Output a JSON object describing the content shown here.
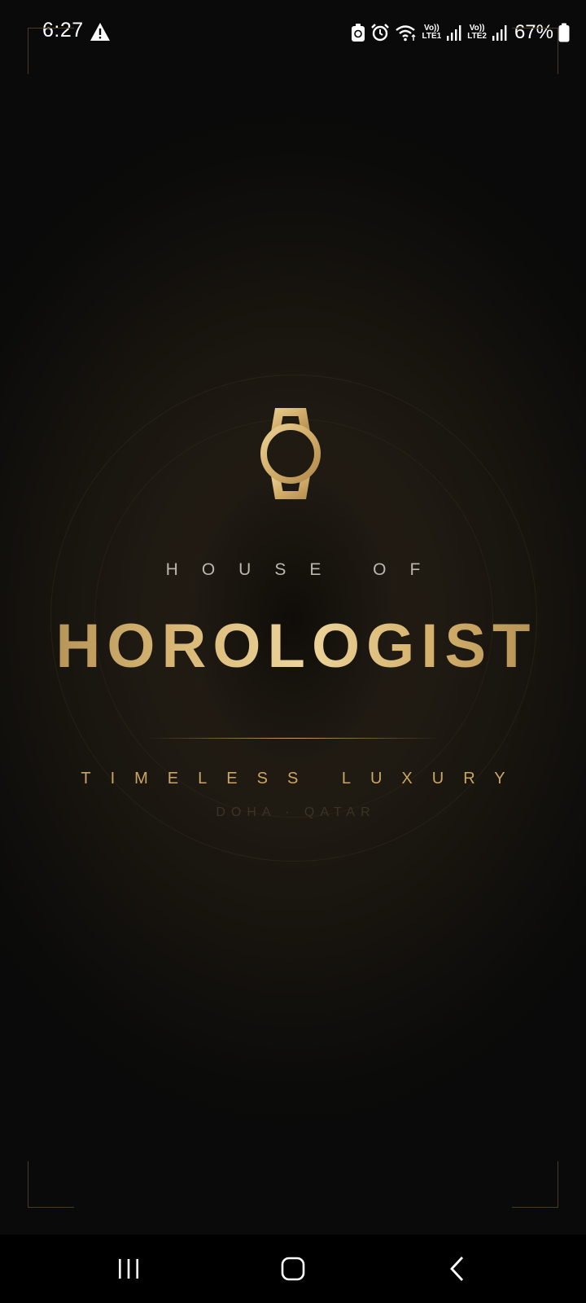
{
  "status_bar": {
    "time": "6:27",
    "sim1_volte": "Vo))",
    "sim1_network": "LTE1",
    "sim2_volte": "Vo))",
    "sim2_network": "LTE2",
    "battery_percent": "67%"
  },
  "icons": {
    "warning": "warning-icon",
    "data_saver": "data-saver-icon",
    "alarm": "alarm-icon",
    "wifi": "wifi-icon",
    "signal": "signal-icon",
    "battery": "battery-icon",
    "watch": "watch-icon"
  },
  "splash": {
    "prefix": "HOUSE OF",
    "brand": "HOROLOGIST",
    "tagline": "TIMELESS LUXURY",
    "location": "DOHA · QATAR"
  },
  "colors": {
    "gold": "#c9a664",
    "gold_light": "#ecd59c",
    "background": "#0a0a0a"
  }
}
